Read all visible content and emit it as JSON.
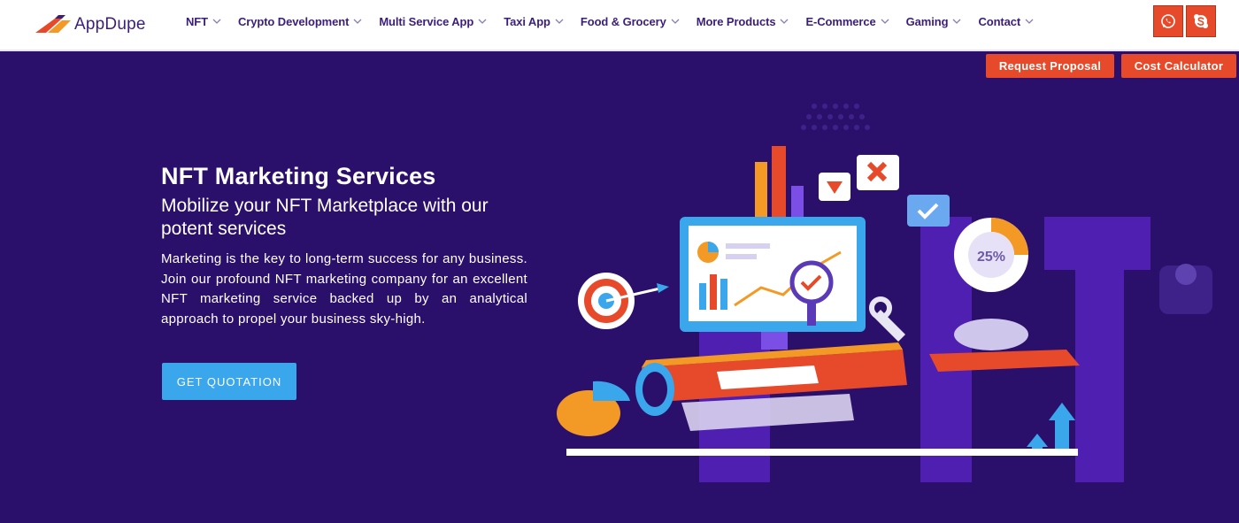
{
  "brand": {
    "name": "AppDupe",
    "accent": "#e64a2a",
    "nav_color": "#3a1e7a",
    "hero_bg": "#2a0f6b"
  },
  "nav": {
    "items": [
      {
        "label": "NFT"
      },
      {
        "label": "Crypto Development"
      },
      {
        "label": "Multi Service App"
      },
      {
        "label": "Taxi App"
      },
      {
        "label": "Food & Grocery"
      },
      {
        "label": "More Products"
      },
      {
        "label": "E-Commerce"
      },
      {
        "label": "Gaming"
      },
      {
        "label": "Contact"
      }
    ],
    "icon": "chevron-down-icon"
  },
  "social": {
    "whatsapp_icon": "whatsapp-icon",
    "skype_icon": "skype-icon"
  },
  "cta": {
    "proposal_label": "Request Proposal",
    "calculator_label": "Cost Calculator"
  },
  "hero": {
    "title": "NFT Marketing Services",
    "subtitle": "Mobilize your NFT Marketplace with our potent services",
    "description": "Marketing is the key to long-term success for any business. Join our profound NFT marketing company for an excellent NFT marketing service backed up by an analytical approach to propel your business sky-high.",
    "button_label": "GET QUOTATION",
    "button_color": "#3aa6ec"
  },
  "illustration": {
    "badge_text": "25%",
    "icon": "nft-marketing-illustration"
  }
}
